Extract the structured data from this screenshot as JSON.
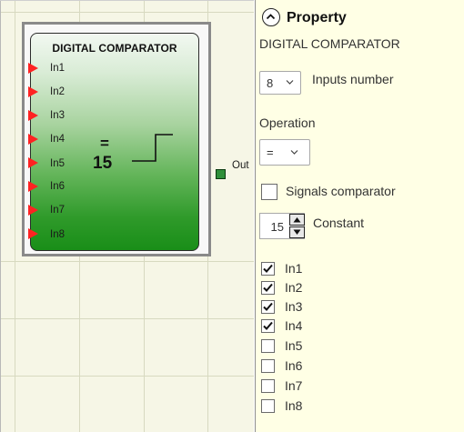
{
  "canvas": {
    "block": {
      "title": "DIGITAL COMPARATOR",
      "inputs": [
        "In1",
        "In2",
        "In3",
        "In4",
        "In5",
        "In6",
        "In7",
        "In8"
      ],
      "operator_symbol": "=",
      "constant_display": "15",
      "output_label": "Out",
      "colors": {
        "input_pin": "#ff2222",
        "output_pin": "#2f8f3a",
        "body_bottom": "#198e18"
      }
    }
  },
  "panel": {
    "title": "Property",
    "block_name": "DIGITAL COMPARATOR",
    "inputs_number": {
      "value": "8",
      "label": "Inputs number"
    },
    "operation": {
      "label": "Operation",
      "value": "="
    },
    "signals_comparator": {
      "label": "Signals comparator",
      "checked": false
    },
    "constant": {
      "value": "15",
      "label": "Constant"
    },
    "channels": [
      {
        "label": "In1",
        "checked": true
      },
      {
        "label": "In2",
        "checked": true
      },
      {
        "label": "In3",
        "checked": true
      },
      {
        "label": "In4",
        "checked": true
      },
      {
        "label": "In5",
        "checked": false
      },
      {
        "label": "In6",
        "checked": false
      },
      {
        "label": "In7",
        "checked": false
      },
      {
        "label": "In8",
        "checked": false
      }
    ],
    "colors": {
      "background": "#ffffe5"
    }
  }
}
